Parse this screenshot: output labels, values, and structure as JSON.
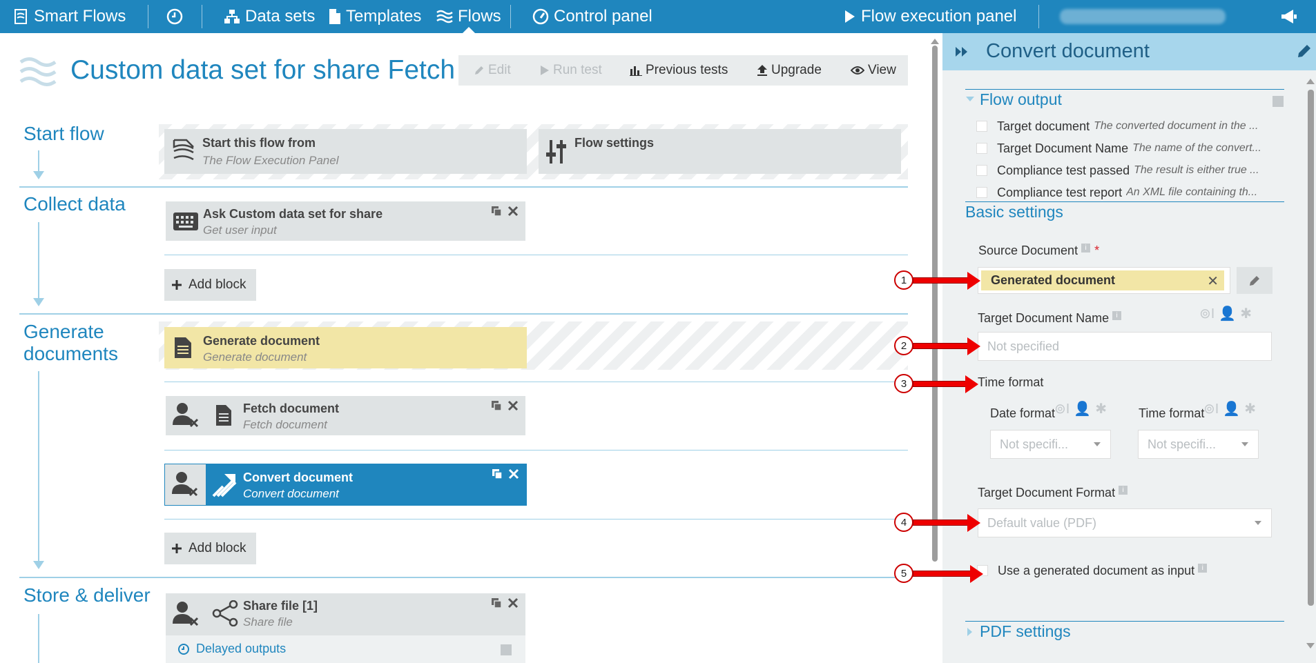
{
  "topbar": {
    "app_name": "Smart Flows",
    "nav": {
      "datasets": "Data sets",
      "templates": "Templates",
      "flows": "Flows",
      "control_panel": "Control panel"
    },
    "flow_execution_panel": "Flow execution panel"
  },
  "editor": {
    "title": "Custom data set for share Fetch",
    "toolbar": {
      "edit": "Edit",
      "run_test": "Run test",
      "previous_tests": "Previous tests",
      "upgrade": "Upgrade",
      "view": "View"
    },
    "sections": {
      "start": "Start flow",
      "collect": "Collect data",
      "generate_line1": "Generate",
      "generate_line2": "documents",
      "store": "Store & deliver"
    },
    "blocks": {
      "start_from": {
        "title": "Start this flow from",
        "subtitle": "The Flow Execution Panel"
      },
      "flow_settings": {
        "title": "Flow settings"
      },
      "ask": {
        "title": "Ask Custom data set for share",
        "subtitle": "Get user input"
      },
      "generate": {
        "title": "Generate document",
        "subtitle": "Generate document"
      },
      "fetch": {
        "title": "Fetch document",
        "subtitle": "Fetch document"
      },
      "convert": {
        "title": "Convert document",
        "subtitle": "Convert document"
      },
      "share": {
        "title": "Share file [1]",
        "subtitle": "Share file"
      }
    },
    "add_block": "Add block",
    "delayed_outputs": "Delayed outputs"
  },
  "panel": {
    "title": "Convert document",
    "flow_output": {
      "title": "Flow output",
      "items": [
        {
          "name": "Target document",
          "desc": "The converted document in the ..."
        },
        {
          "name": "Target Document Name",
          "desc": "The name of the convert..."
        },
        {
          "name": "Compliance test passed",
          "desc": "The result is either true ..."
        },
        {
          "name": "Compliance test report",
          "desc": "An XML file containing th..."
        }
      ]
    },
    "basic_settings": {
      "title": "Basic settings",
      "source_document_label": "Source Document",
      "source_document_value": "Generated document",
      "target_name_label": "Target Document Name",
      "target_name_placeholder": "Not specified",
      "time_format_label": "Time format",
      "date_format_label": "Date format",
      "date_format_value": "Not specifi...",
      "time_format_sub_label": "Time format",
      "time_format_value": "Not specifi...",
      "target_format_label": "Target Document Format",
      "target_format_value": "Default value (PDF)",
      "use_generated_label": "Use a generated document as input"
    },
    "pdf_settings": "PDF settings"
  },
  "callouts": [
    "1",
    "2",
    "3",
    "4",
    "5"
  ],
  "colors": {
    "brand": "#1f86be",
    "panel_header": "#a7d6ec",
    "generated_chip": "#f2e6a6",
    "callout_arrow": "#e00000"
  }
}
